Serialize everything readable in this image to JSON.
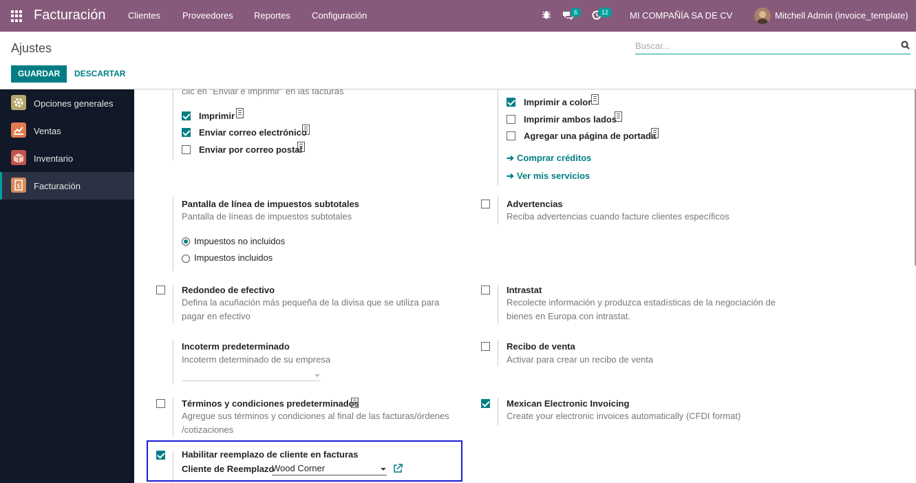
{
  "topbar": {
    "brand": "Facturación",
    "menus": [
      "Clientes",
      "Proveedores",
      "Reportes",
      "Configuración"
    ],
    "chat_count": "6",
    "activity_count": "12",
    "company": "MI COMPAÑÍA SA DE CV",
    "user": "Mitchell Admin (invoice_template)"
  },
  "control_panel": {
    "title": "Ajustes",
    "search_placeholder": "Buscar...",
    "save_label": "GUARDAR",
    "discard_label": "DESCARTAR"
  },
  "sidebar": {
    "items": [
      {
        "label": "Opciones generales",
        "color": "#b5a66a"
      },
      {
        "label": "Ventas",
        "color": "#e07a4f"
      },
      {
        "label": "Inventario",
        "color": "#c1544f"
      },
      {
        "label": "Facturación",
        "color": "#d8895a"
      }
    ]
  },
  "settings": {
    "send_desc_partial": "clic en \"Enviar e imprimir\" en las facturas",
    "send_options": [
      {
        "label": "Imprimir",
        "checked": true
      },
      {
        "label": "Enviar correo electrónico",
        "checked": true
      },
      {
        "label": "Enviar por correo postal",
        "checked": false
      }
    ],
    "print_options": [
      {
        "label": "Imprimir a color",
        "checked": true
      },
      {
        "label": "Imprimir ambos lados",
        "checked": false
      },
      {
        "label": "Agregar una página de portada",
        "checked": false
      }
    ],
    "links": [
      "Comprar créditos",
      "Ver mis servicios"
    ],
    "tax_subtotals": {
      "label": "Pantalla de línea de impuestos subtotales",
      "desc": "Pantalla de líneas de impuestos subtotales",
      "options": [
        {
          "label": "Impuestos no incluidos",
          "selected": true
        },
        {
          "label": "Impuestos incluidos",
          "selected": false
        }
      ]
    },
    "warnings": {
      "label": "Advertencias",
      "desc": "Reciba advertencias cuando facture clientes específicos",
      "checked": false
    },
    "cash_rounding": {
      "label": "Redondeo de efectivo",
      "desc1": "Defina la acuñación más pequeña de la divisa que se utiliza para",
      "desc2": "pagar en efectivo",
      "checked": false
    },
    "intrastat": {
      "label": "Intrastat",
      "desc1": "Recolecte información y produzca estadísticas de la negociación de",
      "desc2": "bienes en Europa con intrastat.",
      "checked": false
    },
    "incoterm": {
      "label": "Incoterm predeterminado",
      "desc": "Incoterm determinado de su empresa",
      "value": ""
    },
    "sale_receipt": {
      "label": "Recibo de venta",
      "desc": "Activar para crear un recibo de venta",
      "checked": false
    },
    "terms": {
      "label": "Términos y condiciones predeterminados",
      "desc1": "Agregue sus términos y condiciones al final de las facturas/órdenes",
      "desc2": "/cotizaciones",
      "checked": false
    },
    "mx_einvoice": {
      "label": "Mexican Electronic Invoicing",
      "desc": "Create your electronic invoices automatically (CFDI format)",
      "checked": true
    },
    "replacement": {
      "label": "Habilitar reemplazo de cliente en facturas",
      "field_label": "Cliente de Reemplazo",
      "value": "Wood Corner",
      "checked": true
    }
  }
}
